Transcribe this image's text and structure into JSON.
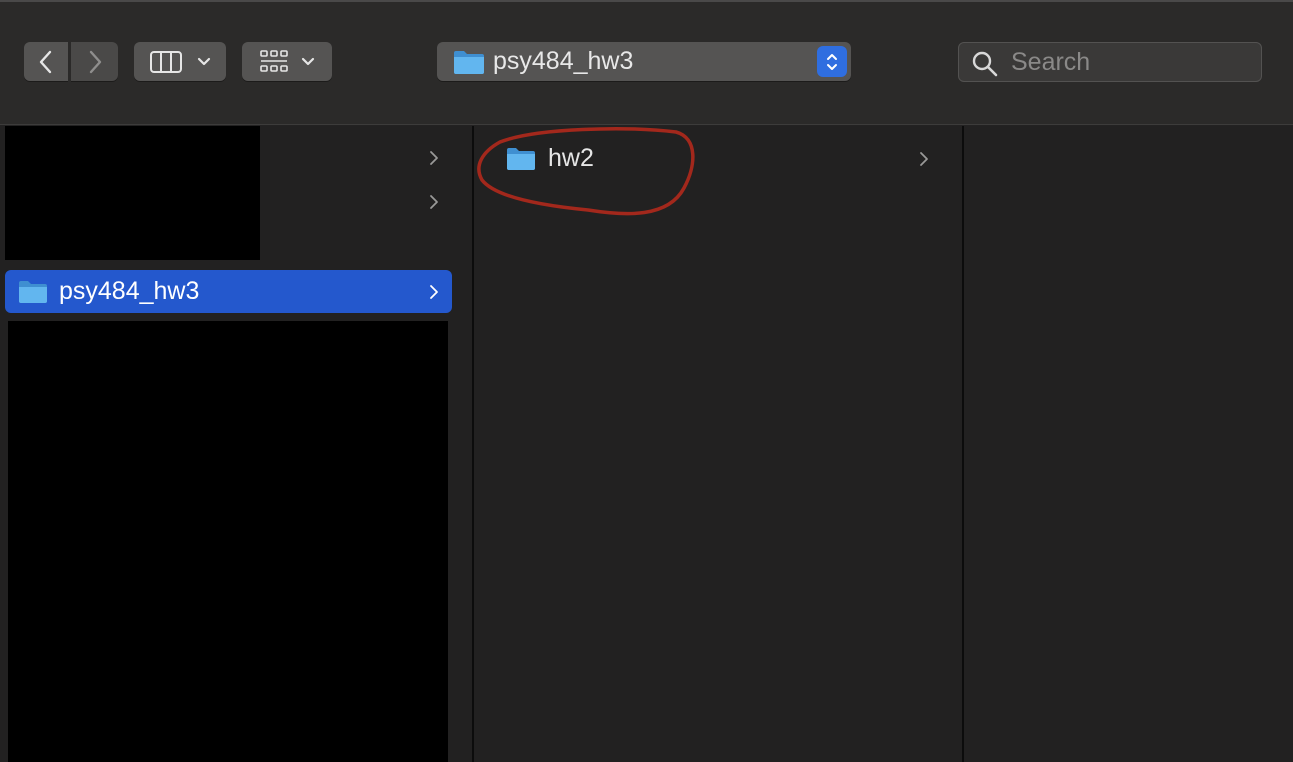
{
  "toolbar": {
    "back_icon": "chevron-left-icon",
    "forward_icon": "chevron-right-icon",
    "view_mode_icon": "columns-view-icon",
    "group_icon": "group-grid-icon",
    "path_popup": {
      "label": "psy484_hw3",
      "icon": "folder-icon"
    },
    "search": {
      "placeholder": "Search",
      "value": ""
    }
  },
  "columns": [
    {
      "items": [
        {
          "label": "",
          "redacted": true,
          "has_children": true
        },
        {
          "label": "",
          "redacted": true,
          "has_children": true
        },
        {
          "label": "psy484_hw3",
          "selected": true,
          "has_children": true
        }
      ]
    },
    {
      "items": [
        {
          "label": "hw2",
          "has_children": true,
          "annotated": true
        }
      ]
    },
    {
      "items": []
    }
  ],
  "colors": {
    "selection": "#2458cd",
    "annotation_stroke": "#a3281c",
    "folder_blue": "#5fb2ec"
  }
}
